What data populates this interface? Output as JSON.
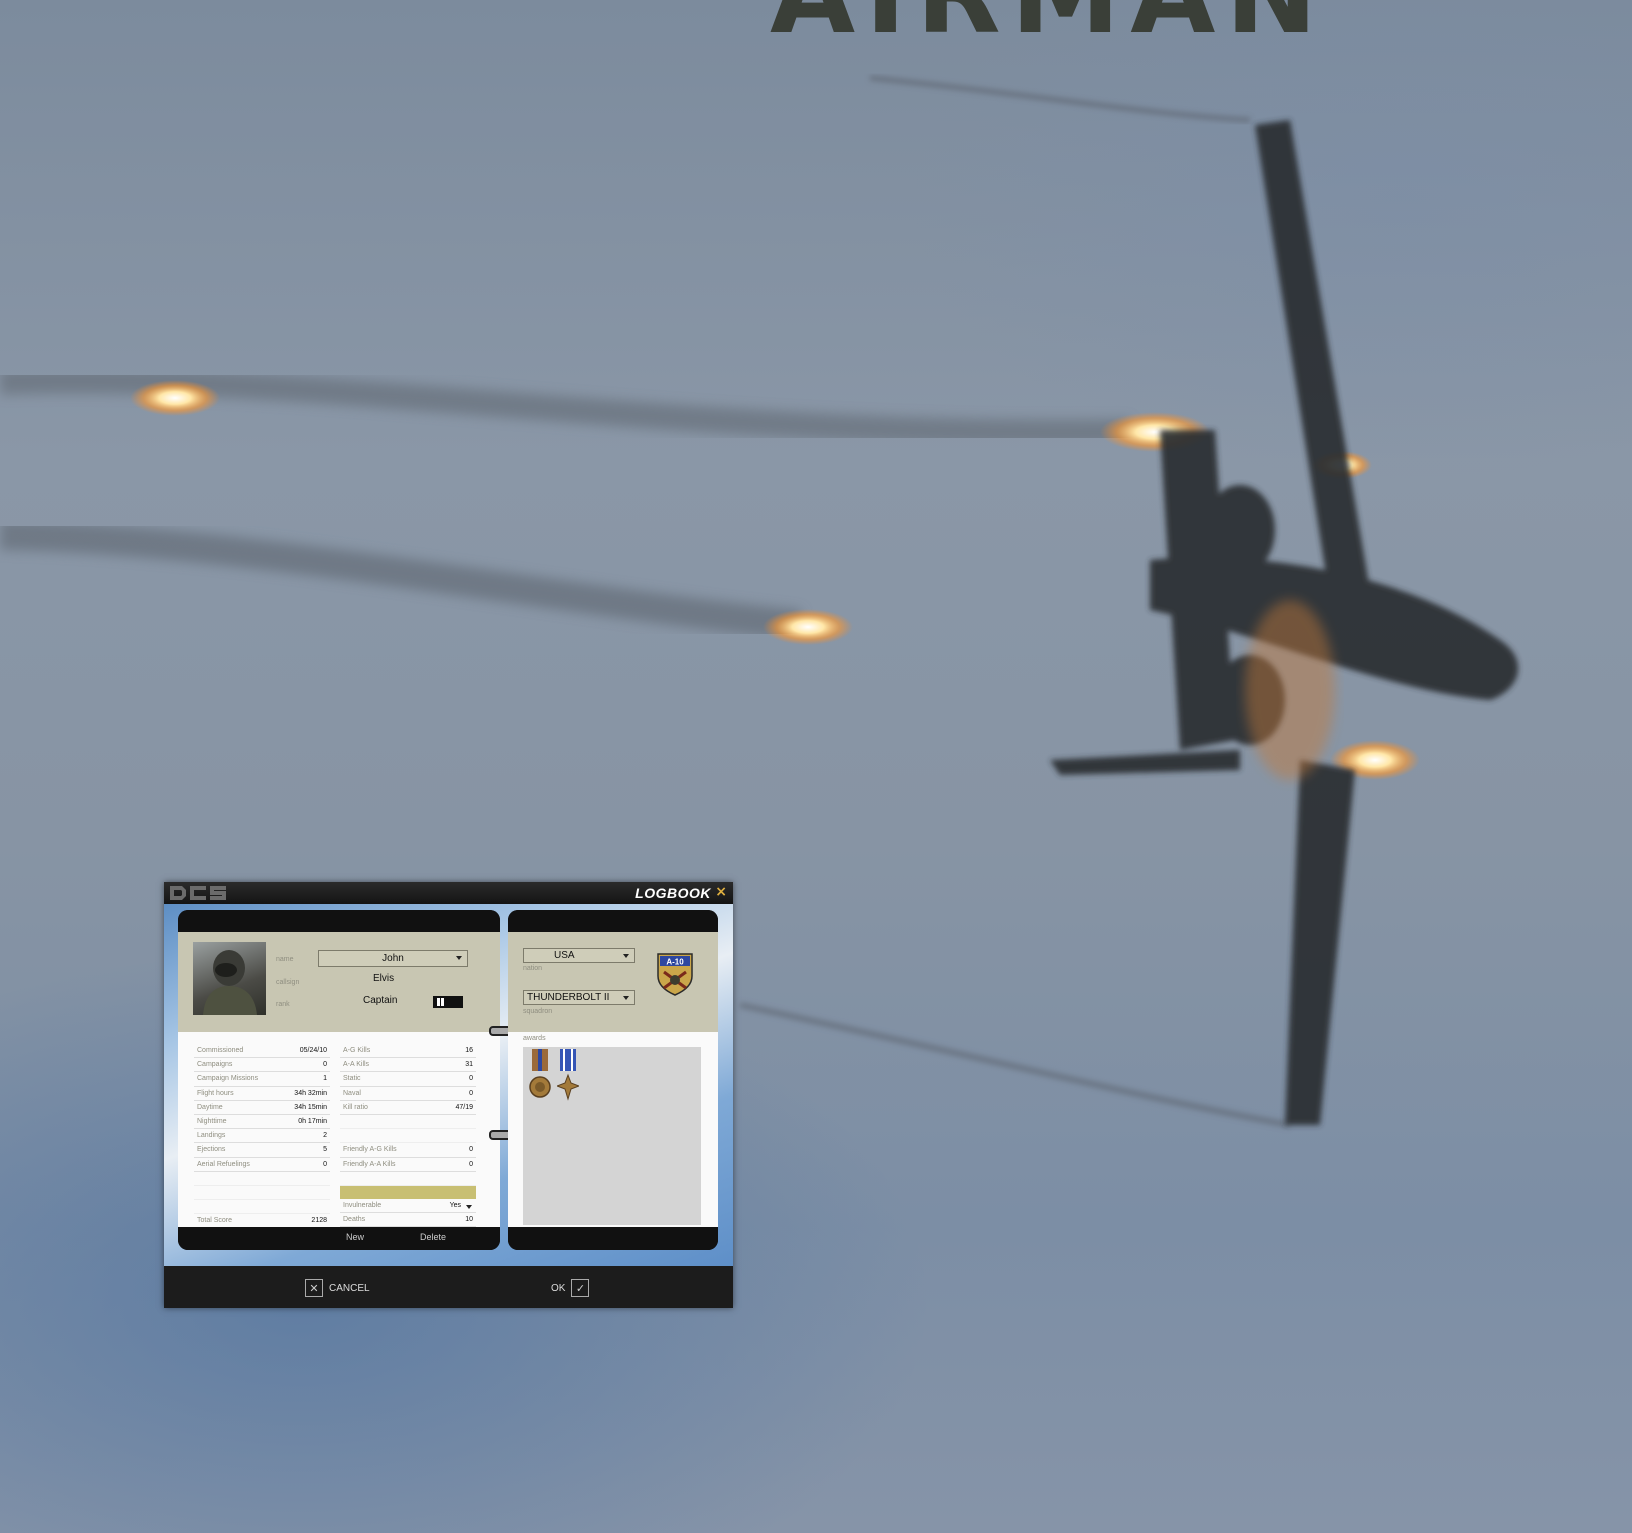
{
  "background": {
    "title_fragment": "AIRMAN"
  },
  "window": {
    "title": "LOGBOOK",
    "close_icon": "close-icon"
  },
  "pilot": {
    "labels": {
      "name": "name",
      "callsign": "callsign",
      "rank": "rank"
    },
    "name": "John",
    "callsign": "Elvis",
    "rank": "Captain"
  },
  "stats_left": [
    {
      "label": "Commissioned",
      "value": "05/24/10"
    },
    {
      "label": "Campaigns",
      "value": "0"
    },
    {
      "label": "Campaign Missions",
      "value": "1"
    },
    {
      "label": "Flight hours",
      "value": "34h 32min"
    },
    {
      "label": "Daytime",
      "value": "34h 15min"
    },
    {
      "label": "Nighttime",
      "value": "0h 17min"
    },
    {
      "label": "Landings",
      "value": "2"
    },
    {
      "label": "Ejections",
      "value": "5"
    },
    {
      "label": "Aerial Refuelings",
      "value": "0"
    }
  ],
  "stats_left_total": {
    "label": "Total Score",
    "value": "2128"
  },
  "stats_right": [
    {
      "label": "A-G Kills",
      "value": "16"
    },
    {
      "label": "A-A Kills",
      "value": "31"
    },
    {
      "label": "Static",
      "value": "0"
    },
    {
      "label": "Naval",
      "value": "0"
    },
    {
      "label": "Kill ratio",
      "value": "47/19"
    }
  ],
  "stats_right_friendly": [
    {
      "label": "Friendly A-G Kills",
      "value": "0"
    },
    {
      "label": "Friendly A-A Kills",
      "value": "0"
    }
  ],
  "stats_right_bottom": {
    "invulnerable_label": "Invulnerable",
    "invulnerable_value": "Yes",
    "deaths_label": "Deaths",
    "deaths_value": "10"
  },
  "left_footer": {
    "new": "New",
    "delete": "Delete"
  },
  "nation": {
    "value": "USA",
    "label": "nation"
  },
  "squadron": {
    "value": "THUNDERBOLT II",
    "label": "squadron",
    "emblem_text": "A-10"
  },
  "awards": {
    "label": "awards"
  },
  "buttons": {
    "cancel": "CANCEL",
    "ok": "OK"
  }
}
